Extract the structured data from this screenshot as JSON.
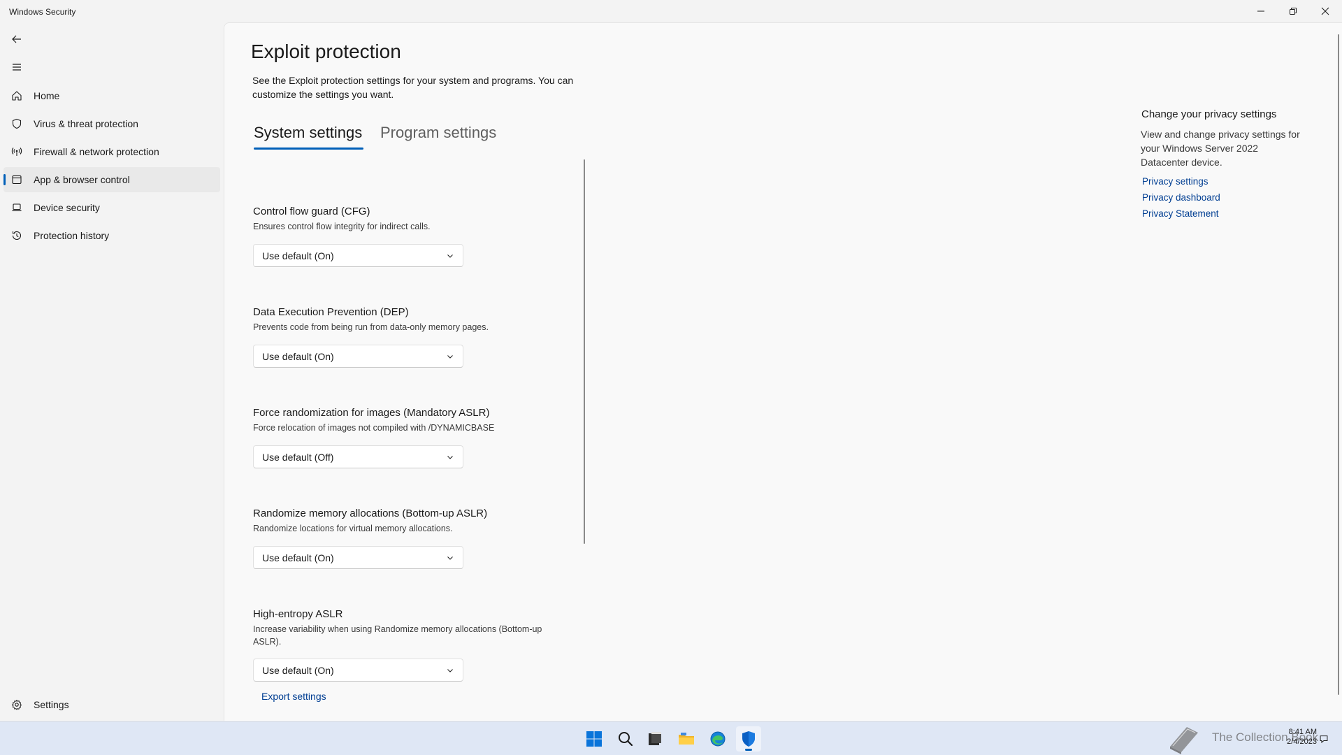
{
  "window": {
    "title": "Windows Security"
  },
  "nav": {
    "items": [
      {
        "label": "Home",
        "icon": "home-icon"
      },
      {
        "label": "Virus & threat protection",
        "icon": "shield-icon"
      },
      {
        "label": "Firewall & network protection",
        "icon": "antenna-icon"
      },
      {
        "label": "App & browser control",
        "icon": "app-window-icon",
        "active": true
      },
      {
        "label": "Device security",
        "icon": "laptop-icon"
      },
      {
        "label": "Protection history",
        "icon": "history-icon"
      }
    ],
    "settings_label": "Settings"
  },
  "page": {
    "title": "Exploit protection",
    "description": "See the Exploit protection settings for your system and programs.  You can customize the settings you want."
  },
  "tabs": [
    {
      "label": "System settings",
      "active": true
    },
    {
      "label": "Program settings",
      "active": false
    }
  ],
  "settings": [
    {
      "title": "Control flow guard (CFG)",
      "description": "Ensures control flow integrity for indirect calls.",
      "value": "Use default (On)"
    },
    {
      "title": "Data Execution Prevention (DEP)",
      "description": "Prevents code from being run from data-only memory pages.",
      "value": "Use default (On)"
    },
    {
      "title": "Force randomization for images (Mandatory ASLR)",
      "description": "Force relocation of images not compiled with /DYNAMICBASE",
      "value": "Use default (Off)"
    },
    {
      "title": "Randomize memory allocations (Bottom-up ASLR)",
      "description": "Randomize locations for virtual memory allocations.",
      "value": "Use default (On)"
    },
    {
      "title": "High-entropy ASLR",
      "description": "Increase variability when using Randomize memory allocations (Bottom-up ASLR).",
      "value": "Use default (On)"
    }
  ],
  "export_label": "Export settings",
  "privacy": {
    "title": "Change your privacy settings",
    "description": "View and change privacy settings for your Windows Server 2022 Datacenter device.",
    "links": [
      "Privacy settings",
      "Privacy dashboard",
      "Privacy Statement"
    ]
  },
  "taskbar": {
    "apps": [
      "windows-start-icon",
      "search-icon",
      "terminal-icon",
      "file-explorer-icon",
      "edge-icon",
      "windows-security-icon"
    ],
    "watermark": "The Collection Book",
    "time": "8:41 AM",
    "date": "2/4/2023"
  },
  "colors": {
    "accent": "#005fb8",
    "link": "#003e92"
  }
}
